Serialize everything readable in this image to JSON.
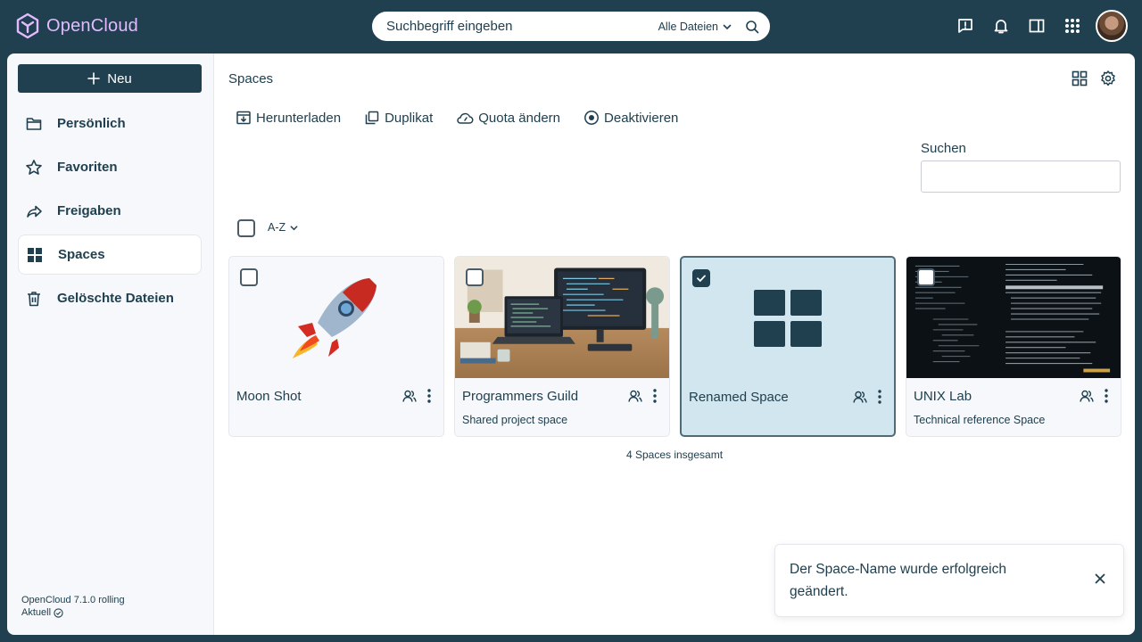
{
  "app": {
    "name": "OpenCloud"
  },
  "colors": {
    "accent": "#20404f",
    "logo": "#e2baff",
    "selected_card": "#d2e6f0"
  },
  "search": {
    "placeholder": "Suchbegriff eingeben",
    "scope": "Alle Dateien"
  },
  "sidebar": {
    "new_label": "Neu",
    "items": [
      {
        "label": "Persönlich",
        "icon": "folder-icon"
      },
      {
        "label": "Favoriten",
        "icon": "star-icon"
      },
      {
        "label": "Freigaben",
        "icon": "share-icon"
      },
      {
        "label": "Spaces",
        "icon": "spaces-grid-icon",
        "active": true
      },
      {
        "label": "Gelöschte Dateien",
        "icon": "trash-icon"
      }
    ],
    "version": "OpenCloud 7.1.0 rolling",
    "status": "Aktuell"
  },
  "main": {
    "breadcrumb": "Spaces",
    "actions": [
      "Herunterladen",
      "Duplikat",
      "Quota ändern",
      "Deaktivieren"
    ],
    "filter_label": "Suchen",
    "sort_label": "A-Z",
    "cards": [
      {
        "title": "Moon Shot",
        "description": "",
        "selected": false,
        "image": "rocket-emoji"
      },
      {
        "title": "Programmers Guild",
        "description": "Shared project space",
        "selected": false,
        "image": "desk-photo"
      },
      {
        "title": "Renamed Space",
        "description": "",
        "selected": true,
        "image": "spaces-grid-icon"
      },
      {
        "title": "UNIX Lab",
        "description": "Technical reference Space",
        "selected": false,
        "image": "terminal-photo"
      }
    ],
    "total": "4 Spaces insgesamt"
  },
  "toast": {
    "message": "Der Space-Name wurde erfolgreich geändert."
  }
}
